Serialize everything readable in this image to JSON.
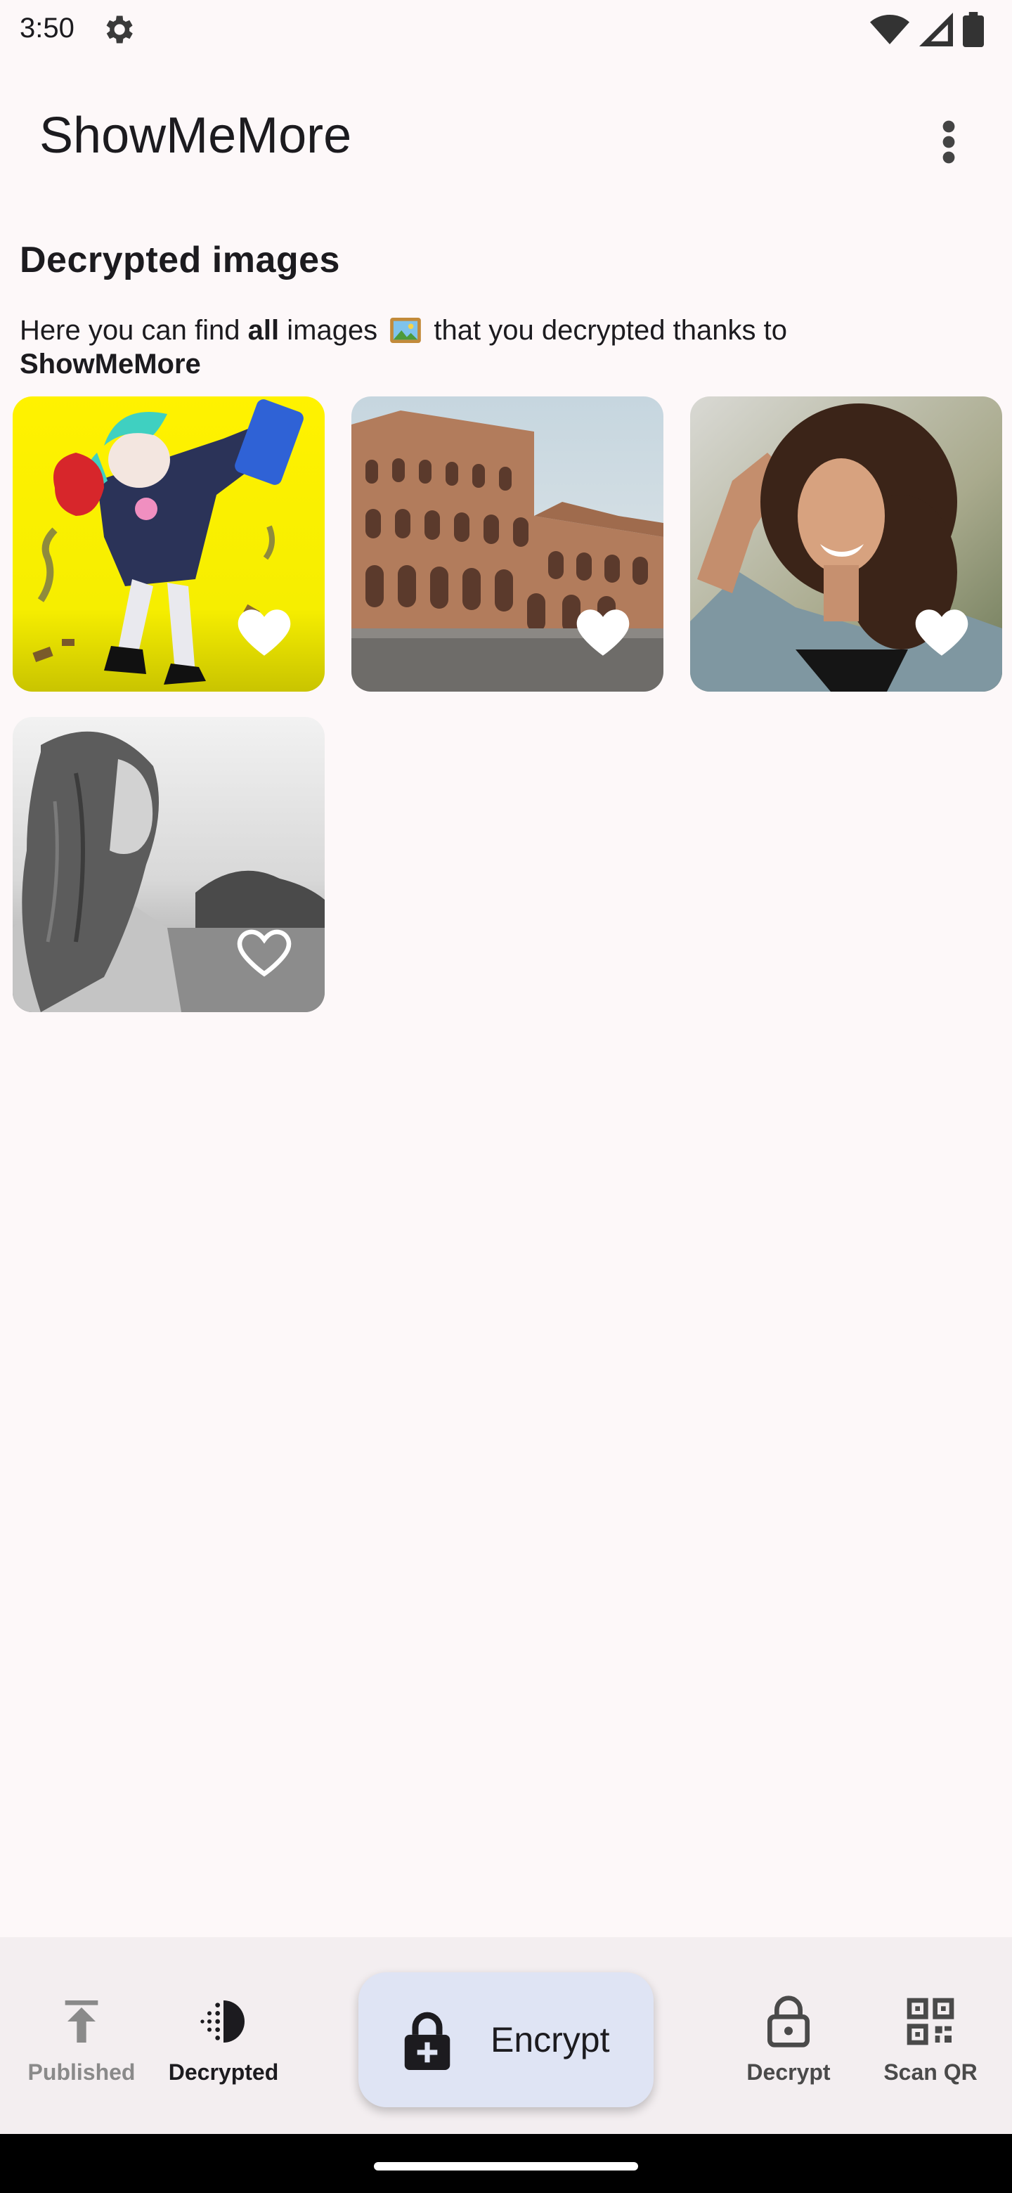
{
  "status_bar": {
    "time": "3:50",
    "icons": [
      "settings-gear-icon",
      "wifi-icon",
      "cell-signal-icon",
      "battery-icon"
    ]
  },
  "app_bar": {
    "title": "ShowMeMore",
    "menu_icon": "more-vert-icon"
  },
  "section": {
    "title": "Decrypted images",
    "desc_part1": "Here you can find ",
    "desc_bold1": "all",
    "desc_part2": " images ",
    "desc_part3": " that you decrypted thanks to",
    "desc_bold2": "ShowMeMore"
  },
  "images": [
    {
      "subject": "anime character illustration",
      "favorite": true
    },
    {
      "subject": "Colosseum",
      "favorite": true
    },
    {
      "subject": "woman with curly hair",
      "favorite": true
    },
    {
      "subject": "woman black and white",
      "favorite": false
    }
  ],
  "bottom_nav": {
    "items": [
      {
        "label": "Published",
        "icon": "upload-icon",
        "selected": false
      },
      {
        "label": "Decrypted",
        "icon": "decrypted-icon",
        "selected": true
      },
      {
        "label": "Decrypt",
        "icon": "lock-open-icon",
        "selected": false
      },
      {
        "label": "Scan QR",
        "icon": "qr-scan-icon",
        "selected": false
      }
    ],
    "fab_label": "Encrypt",
    "fab_icon": "lock-add-icon"
  },
  "colors": {
    "background": "#fdf8f9",
    "nav_background": "#f3eef0",
    "fab_background": "#dfe4f4",
    "text": "#1c1b1f",
    "muted": "#777680"
  }
}
